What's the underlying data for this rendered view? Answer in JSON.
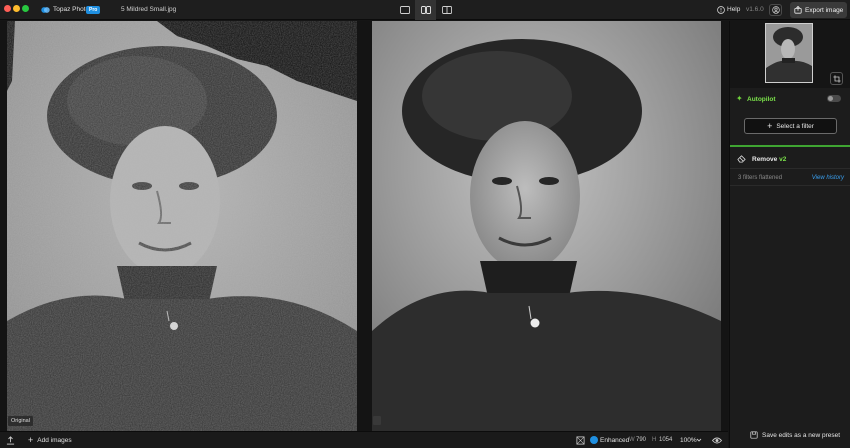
{
  "titlebar": {
    "app_name": "Topaz Photo",
    "badge": "Pro",
    "file_name": "5 Mildred Small.jpg",
    "help_label": "Help",
    "version": "v1.6.0",
    "export_label": "Export image",
    "accent_color": "#1f8fe0"
  },
  "views": [
    {
      "icon": "single-view-icon",
      "active": false
    },
    {
      "icon": "split-view-icon",
      "active": true
    },
    {
      "icon": "side-by-side-view-icon",
      "active": false
    }
  ],
  "canvas": {
    "original_label": "Original"
  },
  "bottombar": {
    "add_images_label": "Add images",
    "enhanced_label": "Enhanced",
    "width_label": "W",
    "width_value": "790",
    "height_label": "H",
    "height_value": "1054",
    "zoom": "100%"
  },
  "panel": {
    "autopilot_label": "Autopilot",
    "autopilot_enabled": false,
    "autopilot_color": "#7be24a",
    "select_filter_label": "Select a filter",
    "remove_label": "Remove",
    "remove_version": "v2",
    "flattened_label": "3 filters flattened",
    "view_history_label": "View history",
    "save_preset_label": "Save edits as a new preset"
  }
}
